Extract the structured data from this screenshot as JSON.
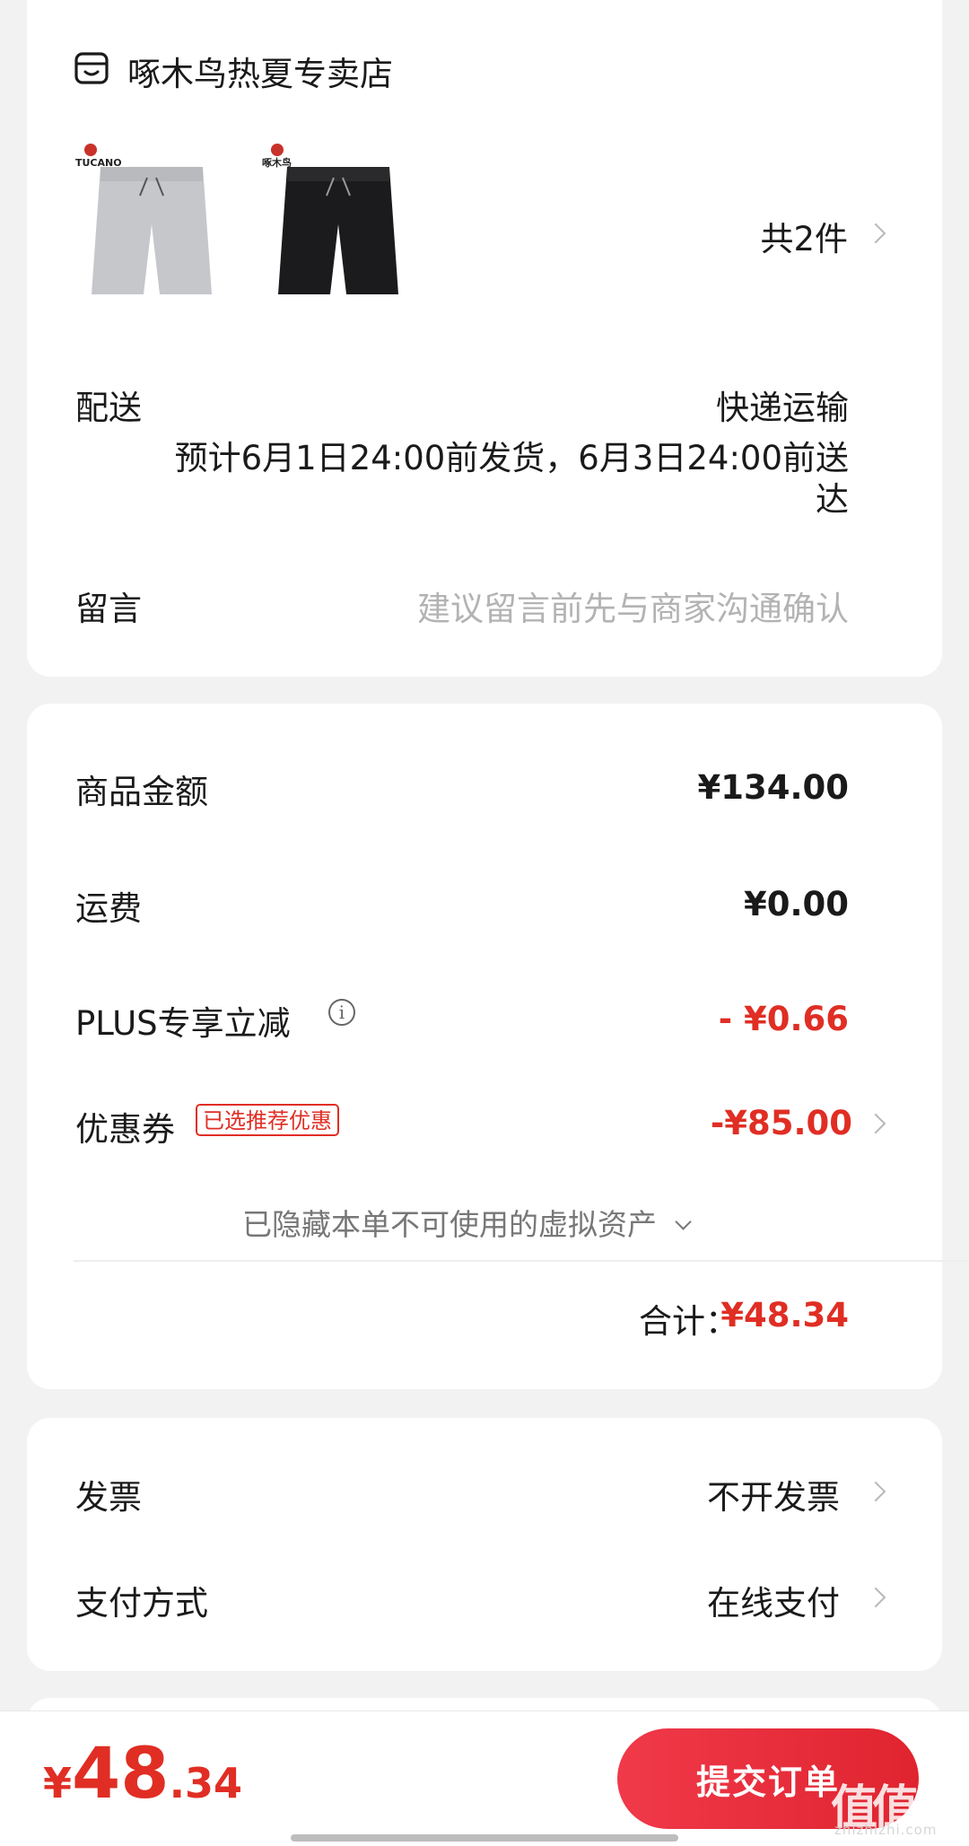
{
  "store": {
    "name": "啄木鸟热夏专卖店",
    "icon": "shop-icon",
    "products": [
      {
        "brand": "TUCANO",
        "brand_cn": "啄木鸟",
        "color": "#c6c7cb",
        "desc": "light gray shorts"
      },
      {
        "brand": "TUCANO",
        "brand_cn": "啄木鸟",
        "color": "#1b1b1d",
        "desc": "black shorts"
      }
    ],
    "count_label": "共2件"
  },
  "delivery": {
    "label": "配送",
    "method": "快递运输",
    "estimate_line1": "预计6月1日24:00前发货，6月3日24:00前送",
    "estimate_line2": "达"
  },
  "message": {
    "label": "留言",
    "placeholder": "建议留言前先与商家沟通确认"
  },
  "price": {
    "goods_label": "商品金额",
    "goods_value": "¥134.00",
    "shipping_label": "运费",
    "shipping_value": "¥0.00",
    "plus_label": "PLUS专享立减",
    "plus_value": "- ¥0.66",
    "coupon_label": "优惠券",
    "coupon_tag": "已选推荐优惠",
    "coupon_value": "-¥85.00",
    "hidden_assets": "已隐藏本单不可使用的虚拟资产",
    "total_label": "合计：",
    "total_value": "¥48.34"
  },
  "invoice": {
    "label": "发票",
    "value": "不开发票"
  },
  "payment": {
    "label": "支付方式",
    "value": "在线支付"
  },
  "bottom": {
    "currency": "¥",
    "amount_int": "48",
    "amount_dec": ".34",
    "submit_label": "提交订单"
  },
  "watermark": {
    "text": "值值值",
    "site": "zhizhizhi.com"
  },
  "colors": {
    "accent": "#e02e24",
    "background": "#f2f2f2"
  }
}
